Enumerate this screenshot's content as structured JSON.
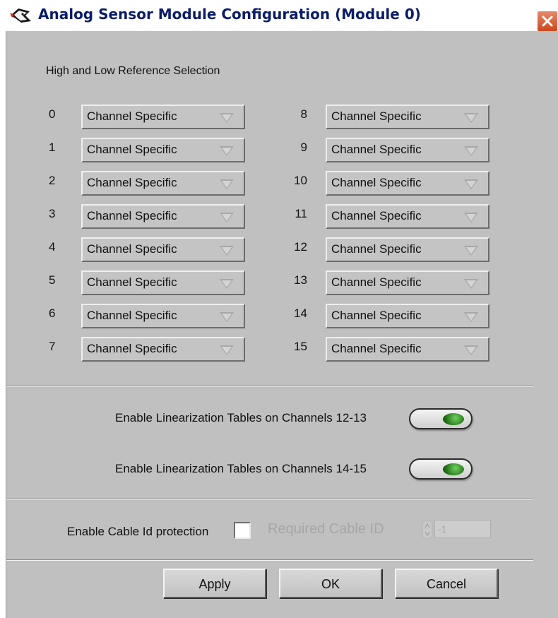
{
  "window": {
    "title": "Analog Sensor Module Configuration (Module 0)"
  },
  "reference": {
    "section_label": "High and Low Reference Selection",
    "left_channels": [
      {
        "channel": "0",
        "value": "Channel Specific"
      },
      {
        "channel": "1",
        "value": "Channel Specific"
      },
      {
        "channel": "2",
        "value": "Channel Specific"
      },
      {
        "channel": "3",
        "value": "Channel Specific"
      },
      {
        "channel": "4",
        "value": "Channel Specific"
      },
      {
        "channel": "5",
        "value": "Channel Specific"
      },
      {
        "channel": "6",
        "value": "Channel Specific"
      },
      {
        "channel": "7",
        "value": "Channel Specific"
      }
    ],
    "right_channels": [
      {
        "channel": "8",
        "value": "Channel Specific"
      },
      {
        "channel": "9",
        "value": "Channel Specific"
      },
      {
        "channel": "10",
        "value": "Channel Specific"
      },
      {
        "channel": "11",
        "value": "Channel Specific"
      },
      {
        "channel": "12",
        "value": "Channel Specific"
      },
      {
        "channel": "13",
        "value": "Channel Specific"
      },
      {
        "channel": "14",
        "value": "Channel Specific"
      },
      {
        "channel": "15",
        "value": "Channel Specific"
      }
    ]
  },
  "linearization": {
    "toggle_12_13_label": "Enable Linearization Tables on Channels 12-13",
    "toggle_14_15_label": "Enable Linearization Tables on Channels 14-15",
    "led_color": "#2f8f22"
  },
  "cable": {
    "protection_label": "Enable Cable Id protection",
    "protection_checked": false,
    "required_id_label": "Required Cable ID",
    "required_id_value": "-1"
  },
  "buttons": {
    "apply": "Apply",
    "ok": "OK",
    "cancel": "Cancel"
  }
}
